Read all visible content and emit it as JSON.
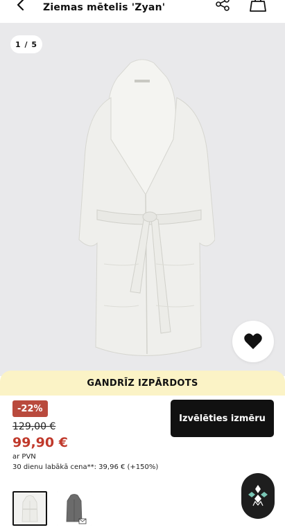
{
  "header": {
    "title": "Ziemas mētelis 'Zyan'",
    "back_icon": "chevron-left-icon",
    "share_icon": "share-icon",
    "cart_icon": "shopping-bag-icon"
  },
  "gallery": {
    "counter": "1 / 5",
    "favorite_icon": "heart-icon"
  },
  "banner": {
    "text": "GANDRĪZ IZPĀRDOTS"
  },
  "pricing": {
    "discount": "-22%",
    "old_price": "129,00 €",
    "new_price": "99,90 €",
    "vat": "ar PVN",
    "lowest": "30 dienu labākā cena**: 39,96 € (+150%)"
  },
  "actions": {
    "select_size": "Izvēlēties izmēru"
  },
  "thumbnails": [
    {
      "color": "#efefec",
      "selected": true
    },
    {
      "color": "#6b6b6b",
      "selected": false
    }
  ],
  "colors": {
    "accent_red": "#c0392b",
    "badge_red": "#b94a3d",
    "banner_yellow": "#fbf3c6",
    "button_black": "#111111"
  }
}
